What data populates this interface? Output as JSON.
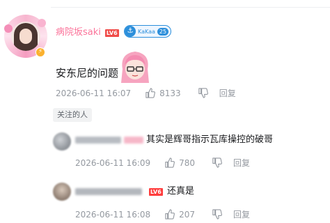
{
  "comment": {
    "username": "病院坂saki",
    "level_badge": "LV6",
    "fan_badge": {
      "name": "KaKaa",
      "level": "25"
    },
    "text": "安东尼的问题",
    "time": "2026-06-11 16:07",
    "likes": "8133",
    "reply_label": "回复",
    "tag": "关注的人"
  },
  "replies": [
    {
      "text": "其实是辉哥指示瓦库操控的破哥",
      "time": "2026-06-11 16:09",
      "likes": "780",
      "reply_label": "回复"
    },
    {
      "level_badge": "LV6",
      "text": "还真是",
      "time": "2026-06-11 16:08",
      "likes": "207",
      "reply_label": "回复"
    }
  ],
  "colors": {
    "username": "#fb7299",
    "meta": "#9499a0",
    "fan_badge": "#2c8fdb"
  },
  "icons": [
    "vip-lightning-icon",
    "thumb-up-icon",
    "thumb-down-icon",
    "fan-medal-icon",
    "emoji-sticker-icon"
  ]
}
